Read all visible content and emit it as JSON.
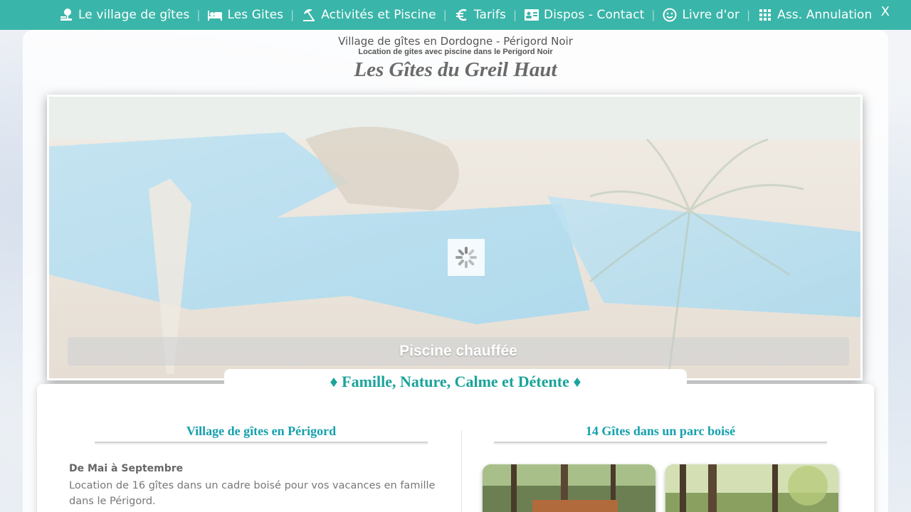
{
  "nav": {
    "items": [
      {
        "label": "Le village de gîtes",
        "icon": "village-icon"
      },
      {
        "label": "Les Gites",
        "icon": "bed-icon"
      },
      {
        "label": "Activités et Piscine",
        "icon": "beach-umbrella-icon"
      },
      {
        "label": "Tarifs",
        "icon": "euro-icon"
      },
      {
        "label": "Dispos - Contact",
        "icon": "contact-card-icon"
      },
      {
        "label": "Livre d'or",
        "icon": "smiley-icon"
      },
      {
        "label": "Ass. Annulation",
        "icon": "grid-apps-icon"
      }
    ],
    "separator": "|",
    "close_label": "X"
  },
  "header": {
    "line1": "Village de gîtes en Dordogne - Périgord Noir",
    "line2": "Location de gites avec piscine dans le Perigord Noir",
    "title": "Les Gîtes du Greil Haut"
  },
  "slider": {
    "caption": "Piscine chauffée",
    "loader_icon": "spinner-icon"
  },
  "tagline": "♦ Famille, Nature, Calme et Détente ♦",
  "left_section": {
    "title": "Village de gîtes en Périgord",
    "heading": "De Mai à Septembre",
    "body": "Location de 16 gîtes dans un cadre boisé pour vos vacances en famille dans le Périgord."
  },
  "right_section": {
    "title": "14 Gîtes dans un parc boisé"
  },
  "colors": {
    "nav_bg": "#3ab5a9",
    "accent_teal": "#1aa39a",
    "section_title": "#15a0ad"
  }
}
